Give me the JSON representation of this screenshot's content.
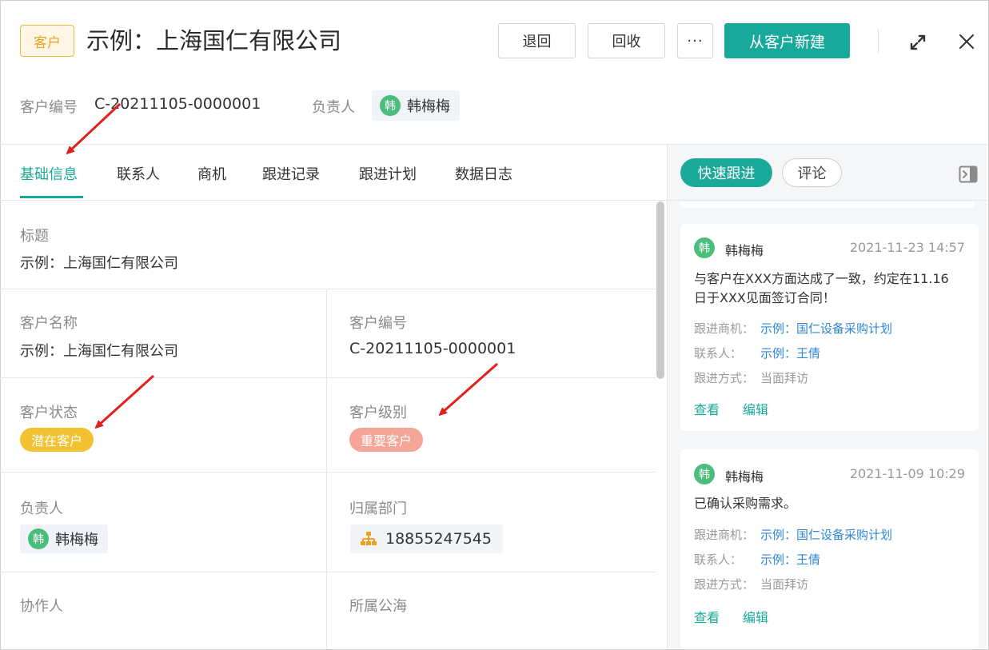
{
  "header": {
    "type_tag": "客户",
    "title": "示例：上海国仁有限公司",
    "buttons": {
      "return": "退回",
      "recycle": "回收",
      "more": "···",
      "primary": "从客户新建"
    }
  },
  "meta": {
    "code_label": "客户编号",
    "code_value": "C-20211105-0000001",
    "owner_label": "负责人",
    "owner_avatar": "韩",
    "owner_name": "韩梅梅"
  },
  "tabs": [
    "基础信息",
    "联系人",
    "商机",
    "跟进记录",
    "跟进计划",
    "数据日志"
  ],
  "fields": {
    "title": {
      "label": "标题",
      "value": "示例：上海国仁有限公司"
    },
    "customer_name": {
      "label": "客户名称",
      "value": "示例：上海国仁有限公司"
    },
    "customer_code": {
      "label": "客户编号",
      "value": "C-20211105-0000001"
    },
    "customer_status": {
      "label": "客户状态",
      "value": "潜在客户"
    },
    "customer_level": {
      "label": "客户级别",
      "value": "重要客户"
    },
    "owner": {
      "label": "负责人",
      "avatar": "韩",
      "value": "韩梅梅"
    },
    "department": {
      "label": "归属部门",
      "value": "18855247545"
    },
    "collaborator": {
      "label": "协作人"
    },
    "public_pool": {
      "label": "所属公海"
    }
  },
  "right_panel": {
    "quick_follow": "快速跟进",
    "comment": "评论",
    "records": [
      {
        "avatar": "韩",
        "author": "韩梅梅",
        "time": "2021-11-23 14:57",
        "content_line1": "与客户在XXX方面达成了一致，约定在11.16",
        "content_line2": "日于XXX见面签订合同！",
        "opportunity_label": "跟进商机：",
        "opportunity_value": "示例：国仁设备采购计划",
        "contact_label": "联系人：",
        "contact_value": "示例：王倩",
        "method_label": "跟进方式：",
        "method_value": "当面拜访",
        "view": "查看",
        "edit": "编辑"
      },
      {
        "avatar": "韩",
        "author": "韩梅梅",
        "time": "2021-11-09 10:29",
        "content_line1": "已确认采购需求。",
        "opportunity_label": "跟进商机：",
        "opportunity_value": "示例：国仁设备采购计划",
        "contact_label": "联系人：",
        "contact_value": "示例：王倩",
        "method_label": "跟进方式：",
        "method_value": "当面拜访",
        "view": "查看",
        "edit": "编辑"
      }
    ]
  },
  "colors": {
    "accent": "#18a99a",
    "tag_orange": "#f0a020",
    "status_yellow": "#f2c232",
    "level_pink": "#f5a597",
    "link_blue": "#2f86d6",
    "arrow_red": "#e0201b"
  },
  "icons": [
    "expand-icon",
    "close-icon",
    "panel-collapse-icon",
    "org-structure-icon"
  ]
}
